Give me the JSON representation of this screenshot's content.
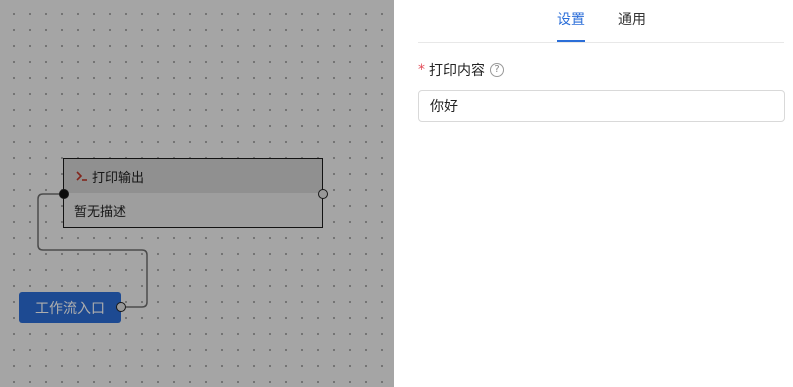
{
  "canvas": {
    "nodes": {
      "print": {
        "title": "打印输出",
        "description": "暂无描述",
        "icon": "terminal-icon"
      },
      "entry": {
        "label": "工作流入口"
      }
    }
  },
  "panel": {
    "tabs": [
      {
        "label": "设置",
        "active": true
      },
      {
        "label": "通用",
        "active": false
      }
    ],
    "field": {
      "label": "打印内容",
      "required_mark": "*",
      "help_icon": "question-circle-icon",
      "value": "你好"
    }
  },
  "colors": {
    "accent": "#2b6ed8",
    "required": "#e34d59",
    "terminal_icon": "#c0392b"
  }
}
